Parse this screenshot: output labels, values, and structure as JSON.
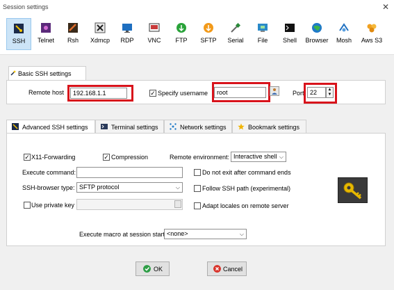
{
  "window": {
    "title": "Session settings",
    "close_glyph": "✕"
  },
  "toolbar": [
    {
      "label": "SSH",
      "icon": "ssh-icon",
      "selected": true
    },
    {
      "label": "Telnet",
      "icon": "telnet-icon"
    },
    {
      "label": "Rsh",
      "icon": "rsh-icon"
    },
    {
      "label": "Xdmcp",
      "icon": "xdmcp-icon"
    },
    {
      "label": "RDP",
      "icon": "rdp-icon"
    },
    {
      "label": "VNC",
      "icon": "vnc-icon"
    },
    {
      "label": "FTP",
      "icon": "ftp-icon"
    },
    {
      "label": "SFTP",
      "icon": "sftp-icon"
    },
    {
      "label": "Serial",
      "icon": "serial-icon"
    },
    {
      "label": "File",
      "icon": "file-icon"
    },
    {
      "label": "Shell",
      "icon": "shell-icon"
    },
    {
      "label": "Browser",
      "icon": "browser-icon"
    },
    {
      "label": "Mosh",
      "icon": "mosh-icon"
    },
    {
      "label": "Aws S3",
      "icon": "aws-s3-icon"
    }
  ],
  "basic": {
    "tab_label": "Basic SSH settings",
    "remote_host_label": "Remote host",
    "remote_host_value": "192.168.1.1",
    "specify_username_label": "Specify username",
    "username_value": "root",
    "port_label": "Port",
    "port_value": "22"
  },
  "advanced_tabs": [
    {
      "label": "Advanced SSH settings",
      "icon": "wrench-icon",
      "selected": true
    },
    {
      "label": "Terminal settings",
      "icon": "terminal-icon"
    },
    {
      "label": "Network settings",
      "icon": "network-icon"
    },
    {
      "label": "Bookmark settings",
      "icon": "star-icon"
    }
  ],
  "advanced": {
    "x11_label": "X11-Forwarding",
    "compression_label": "Compression",
    "remote_env_label": "Remote environment:",
    "remote_env_value": "Interactive shell",
    "execute_command_label": "Execute command:",
    "do_not_exit_label": "Do not exit after command ends",
    "ssh_browser_label": "SSH-browser type:",
    "ssh_browser_value": "SFTP protocol",
    "follow_ssh_label": "Follow SSH path (experimental)",
    "use_private_key_label": "Use private key",
    "adapt_locales_label": "Adapt locales on remote server",
    "macro_label": "Execute macro at session start:",
    "macro_value": "<none>"
  },
  "buttons": {
    "ok": "OK",
    "cancel": "Cancel"
  },
  "colors": {
    "highlight_red": "#d8131b",
    "selected_tab_bg": "#cce4f7",
    "ok_green": "#2e9e46",
    "cancel_red": "#d9342b",
    "key_bg": "#3a3a3a",
    "key_gold": "#e6b800"
  }
}
